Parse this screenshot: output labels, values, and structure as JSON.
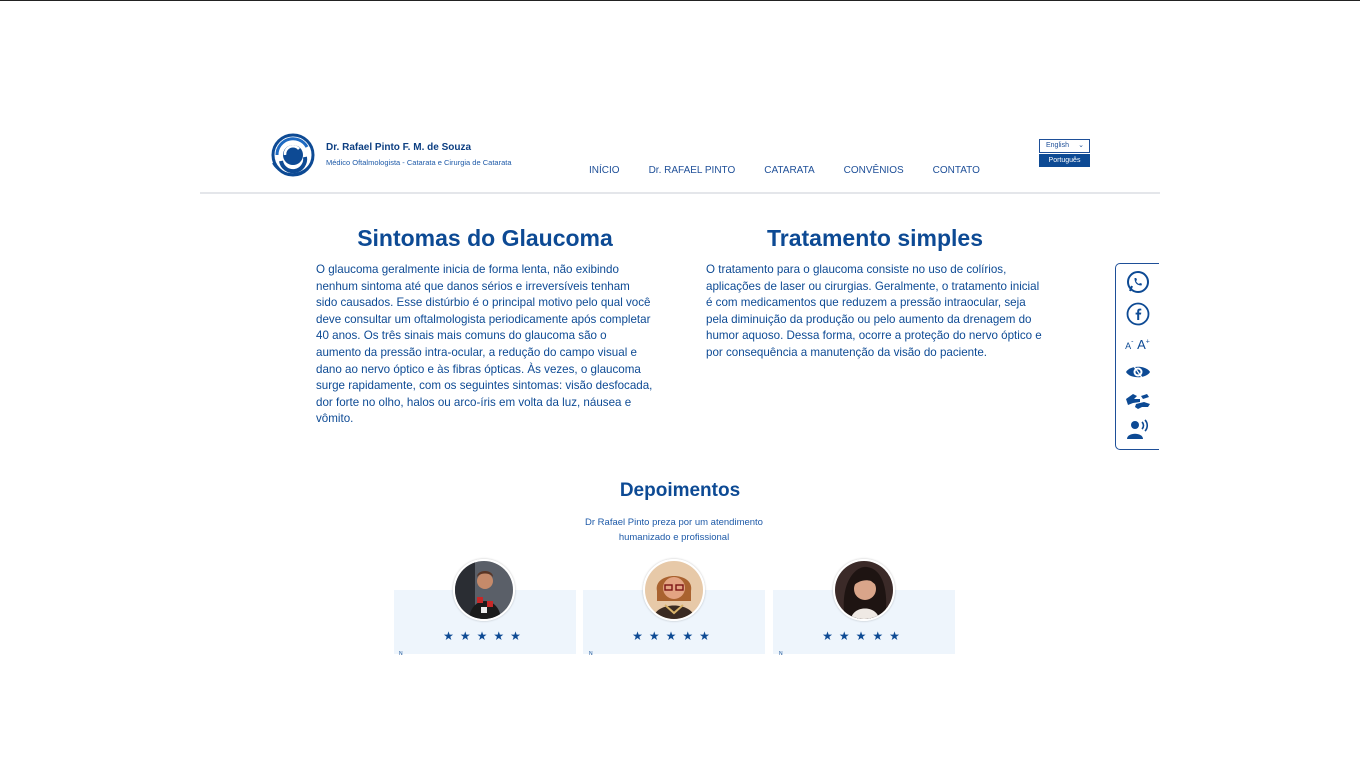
{
  "header": {
    "brand_name": "Dr. Rafael Pinto F. M. de Souza",
    "brand_subtitle": "Médico Oftalmologista - Catarata e Cirurgia de Catarata",
    "nav": [
      "INÍCIO",
      "Dr. RAFAEL PINTO",
      "CATARATA",
      "CONVÊNIOS",
      "CONTATO"
    ],
    "language": {
      "selected": "English",
      "option": "Português"
    }
  },
  "sections": {
    "left": {
      "title": "Sintomas do Glaucoma",
      "body": "O glaucoma geralmente inicia de forma lenta, não exibindo nenhum sintoma até que danos sérios e irreversíveis tenham sido causados. Esse distúrbio é o principal motivo pelo qual você deve consultar um oftalmologista periodicamente após completar 40 anos. Os três sinais mais comuns do glaucoma são o aumento da pressão intra-ocular, a redução do campo visual e dano ao nervo óptico e às fibras ópticas. Às vezes, o glaucoma surge rapidamente, com os seguintes sintomas: visão desfocada, dor forte no olho, halos ou arco-íris em volta da luz, náusea e vômito."
    },
    "right": {
      "title": "Tratamento simples",
      "body": "O tratamento para o glaucoma consiste no uso de colírios, aplicações de laser ou cirurgias. Geralmente, o tratamento inicial é com medicamentos que reduzem a pressão intraocular, seja pela diminuição da produção ou pelo aumento da drenagem do humor aquoso. Dessa forma, ocorre a proteção do nervo óptico e por consequência a manutenção da visão do paciente."
    }
  },
  "accessibility": {
    "icons": [
      "whatsapp-icon",
      "facebook-icon",
      "font-size-icon",
      "eye-contrast-icon",
      "sign-language-icon",
      "screen-reader-icon"
    ],
    "font_small": "A",
    "font_small_sign": "-",
    "font_large": "A",
    "font_large_sign": "+"
  },
  "testimonials": {
    "title": "Depoimentos",
    "subtitle": "Dr Rafael Pinto preza por um atendimento humanizado e profissional",
    "stars": "★★★★★",
    "rating": 5,
    "rating_max": 5,
    "cut_letter": "N"
  },
  "colors": {
    "primary": "#0d4a94",
    "card_bg": "#eef5fc"
  }
}
